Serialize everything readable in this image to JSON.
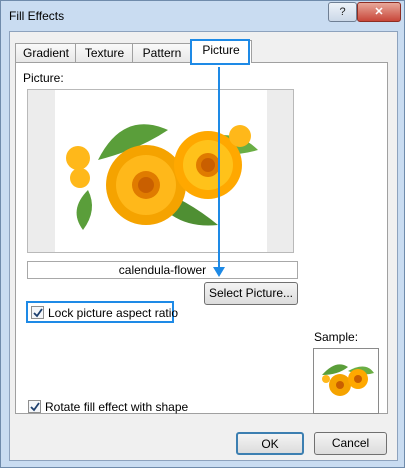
{
  "window": {
    "title": "Fill Effects",
    "help_label": "?",
    "close_label": "✕"
  },
  "tabs": [
    {
      "label": "Gradient",
      "active": false
    },
    {
      "label": "Texture",
      "active": false
    },
    {
      "label": "Pattern",
      "active": false
    },
    {
      "label": "Picture",
      "active": true
    }
  ],
  "picture": {
    "label": "Picture:",
    "filename": "calendula-flower",
    "select_button": "Select Picture...",
    "image_icon": "calendula-flower-image"
  },
  "options": {
    "lock_aspect": {
      "label": "Lock picture aspect ratio",
      "checked": true
    },
    "rotate_fill": {
      "label": "Rotate fill effect with shape",
      "checked": true
    }
  },
  "sample": {
    "label": "Sample:"
  },
  "footer": {
    "ok": "OK",
    "cancel": "Cancel"
  },
  "colors": {
    "highlight": "#1e8ae6",
    "petal": "#f5a300",
    "petal_light": "#ffc21a",
    "leaf": "#5a9e3a"
  }
}
